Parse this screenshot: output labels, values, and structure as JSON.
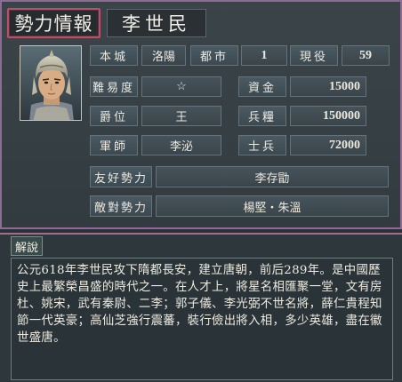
{
  "header": {
    "title": "勢力情報",
    "ruler_name": "李世民"
  },
  "stats": {
    "castle_label": "本城",
    "castle_value": "洛陽",
    "cities_label": "都市",
    "cities_value": "1",
    "officers_label": "現役",
    "officers_value": "59",
    "difficulty_label": "難易度",
    "difficulty_value": "☆",
    "funds_label": "資金",
    "funds_value": "15000",
    "rank_label": "爵位",
    "rank_value": "王",
    "rations_label": "兵糧",
    "rations_value": "150000",
    "advisor_label": "軍師",
    "advisor_value": "李泌",
    "troops_label": "士兵",
    "troops_value": "72000",
    "friendly_label": "友好勢力",
    "friendly_value": "李存勖",
    "hostile_label": "敵對勢力",
    "hostile_value": "楊堅・朱溫"
  },
  "commentary": {
    "label": "解說",
    "text": "公元618年李世民攻下隋都長安，建立唐朝，前后289年。是中國歷史上最繁榮昌盛的時代之一。在人才上，將星名相匯聚一堂，文有房杜、姚宋，武有秦尉、二李；郭子儀、李光弼不世名將，薛仁貴程知節一代英豪；高仙芝強行震蕃，裝行儉出將入相，多少英雄，盡在徽世盛唐。"
  },
  "colors": {
    "frame_accent": "#8e6a94",
    "title_border": "#b5526b",
    "panel_bg": "#323b3f"
  }
}
